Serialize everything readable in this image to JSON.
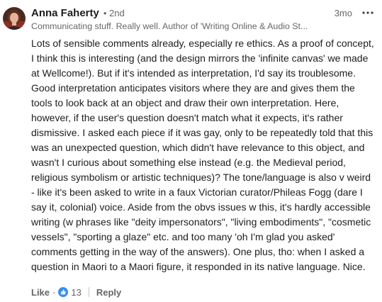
{
  "comment": {
    "author": {
      "name": "Anna Faherty",
      "degree": "• 2nd",
      "headline": "Communicating stuff. Really well. Author of 'Writing Online & Audio St..."
    },
    "timestamp": "3mo",
    "more_icon": "ellipsis-icon",
    "body": "Lots of sensible comments already, especially re ethics. As a proof of concept, I think this is interesting (and the design mirrors the 'infinite canvas' we made at Wellcome!). But if it's intended as interpretation, I'd say its troublesome. Good interpretation anticipates visitors where they are and gives them the tools to look back at an object and draw their own interpretation. Here, however, if the user's question doesn't match what it expects, it's rather dismissive. I asked each piece if it was gay, only to be repeatedly told that this was an unexpected question, which didn't have relevance to this object, and wasn't I curious about something else instead (e.g. the Medieval period, religious symbolism or artistic techniques)? The tone/language is also v weird - like it's been asked to write in a faux Victorian curator/Phileas Fogg (dare I say it, colonial) voice. Aside from the obvs issues w this, it's hardly accessible writing (w phrases like \"deity impersonators\", \"living embodiments\", \"cosmetic vessels\", \"sporting a glaze\" etc. and too many 'oh I'm glad you asked' comments getting in the way of the answers). One plus, tho: when I asked a question in Maori to a Maori figure, it responded in its native language. Nice.",
    "actions": {
      "like_label": "Like",
      "separator": "·",
      "reaction_icon": "thumbs-up-icon",
      "reaction_count": "13",
      "reply_label": "Reply"
    },
    "colors": {
      "accent": "#0a66c2",
      "text": "#1d1d1d",
      "muted": "#666666"
    }
  }
}
